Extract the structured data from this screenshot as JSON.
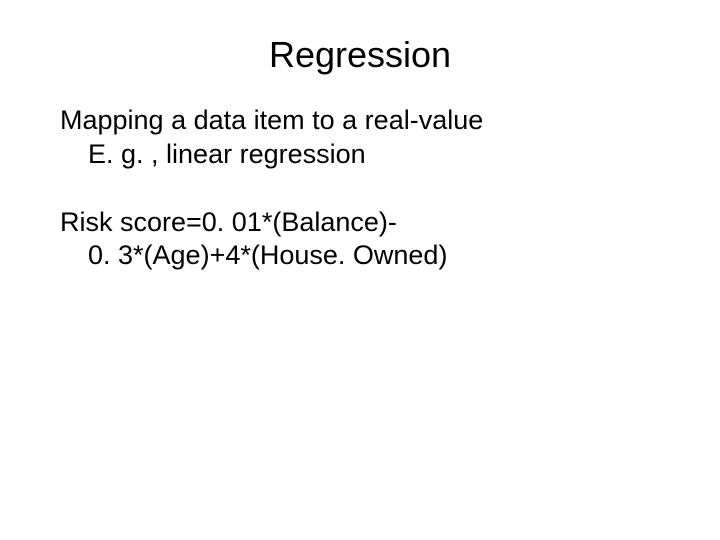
{
  "title": "Regression",
  "line1": "Mapping a data item to a real-value",
  "line2": "E. g. , linear regression",
  "line3": "Risk score=0. 01*(Balance)-",
  "line4": "0. 3*(Age)+4*(House. Owned)"
}
